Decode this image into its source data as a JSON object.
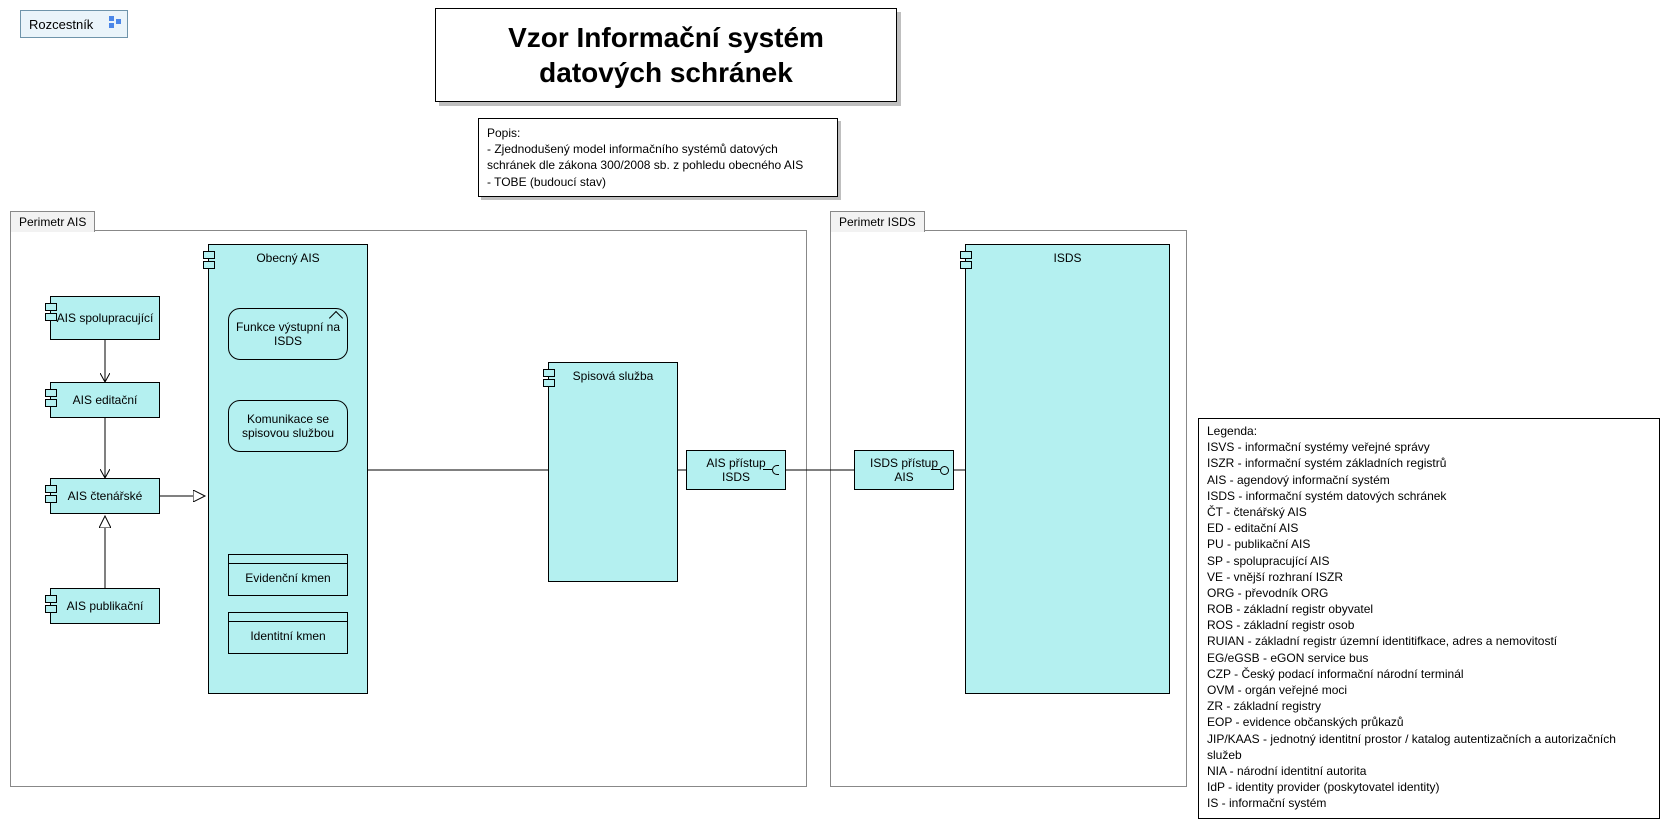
{
  "rozcestnik": "Rozcestník",
  "title": "Vzor Informační systém\ndatových schránek",
  "description": "Popis:\n- Zjednodušený model informačního systémů datových schránek  dle zákona 300/2008 sb. z pohledu obecného AIS\n- TOBE (budoucí stav)",
  "groups": {
    "ais": "Perimetr AIS",
    "isds": "Perimetr ISDS"
  },
  "components": {
    "obecny_ais": "Obecný AIS",
    "ais_spolupracujici": "AIS spolupracující",
    "ais_editacni": "AIS editační",
    "ais_ctenarske": "AIS čtenářské",
    "ais_publikacni": "AIS publikační",
    "spisova_sluzba": "Spisová služba",
    "isds": "ISDS"
  },
  "functions": {
    "vystupni": "Funkce výstupní na ISDS",
    "komunikace": "Komunikace se spisovou službou"
  },
  "data_objects": {
    "evidencni": "Evidenční kmen",
    "identitni": "Identitní kmen"
  },
  "interfaces": {
    "ais_pristup": "AIS přístup ISDS",
    "isds_pristup": "ISDS přístup AIS"
  },
  "legend": "Legenda:\nISVS - informační systémy veřejné správy\nISZR - informační systém základních registrů\nAIS - agendový informační systém\nISDS - informační systém datových schránek\nČT - čtenářský AIS\nED - editační AIS\nPU - publikační AIS\nSP - spolupracující AIS\nVE - vnější rozhraní ISZR\nORG - převodník ORG\nROB - základní registr obyvatel\nROS - základní registr osob\nRUIAN - základní registr územní identitifkace, adres a nemovitostí\nEG/eGSB - eGON service bus\nCZP - Český podací informační národní terminál\nOVM - orgán veřejné moci\nZR - základní registry\nEOP - evidence občanských průkazů\nJIP/KAAS - jednotný identitní prostor / katalog autentizačních a autorizačních služeb\nNIA - národní identitní autorita\nIdP - identity provider (poskytovatel identity)\nIS - informační systém"
}
